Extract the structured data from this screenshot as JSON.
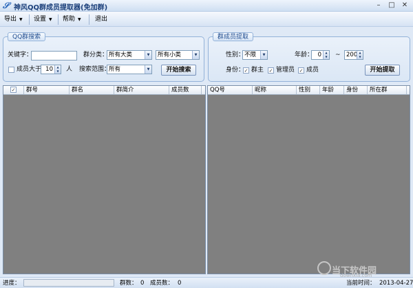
{
  "window": {
    "title": "神风QQ群成员提取器(免加群)",
    "app_icon": "app-logo-icon",
    "controls": {
      "minimize": "–",
      "maximize": "□",
      "close": "✕"
    }
  },
  "menubar": {
    "items": [
      {
        "label": "导出",
        "has_caret": true
      },
      {
        "label": "设置",
        "has_caret": true
      },
      {
        "label": "帮助",
        "has_caret": true
      },
      {
        "label": "退出",
        "has_caret": false
      }
    ],
    "caret": "▼"
  },
  "search_group": {
    "title": "QQ群搜索",
    "keyword_label": "关键字：",
    "keyword_value": "",
    "category_label": "群分类：",
    "category_major": "所有大类",
    "category_minor": "所有小类",
    "members_over_label": "成员大于",
    "members_over_checked": false,
    "members_over_value": "10",
    "members_unit": "人",
    "scope_label": "搜索范围：",
    "scope_value": "所有",
    "start_button": "开始搜索"
  },
  "extract_group": {
    "title": "群成员提取",
    "gender_label": "性别：",
    "gender_value": "不限",
    "age_label": "年龄：",
    "age_from": "0",
    "age_sep": "~",
    "age_to": "200",
    "identity_label": "身份：",
    "roles": [
      {
        "label": "群主",
        "checked": true
      },
      {
        "label": "管理员",
        "checked": true
      },
      {
        "label": "成员",
        "checked": true
      }
    ],
    "start_button": "开始提取"
  },
  "group_table": {
    "columns": [
      "",
      "群号",
      "群名",
      "群简介",
      "成员数"
    ],
    "header_checked": true,
    "rows": []
  },
  "member_table": {
    "columns": [
      "QQ号",
      "昵称",
      "性别",
      "年龄",
      "身份",
      "所在群"
    ],
    "rows": []
  },
  "statusbar": {
    "progress_label": "进度：",
    "progress": 0,
    "group_count_label": "群数：",
    "group_count": "0",
    "member_count_label": "成员数：",
    "member_count": "0",
    "time_label": "当前时间：",
    "time_value": "2013-04-27"
  },
  "watermark": {
    "text": "当下软件园",
    "url_text": "downxia.com"
  },
  "colors": {
    "accent": "#1f4c8f",
    "grid_bg": "#808080",
    "window_bg": "#dfe9f6"
  }
}
